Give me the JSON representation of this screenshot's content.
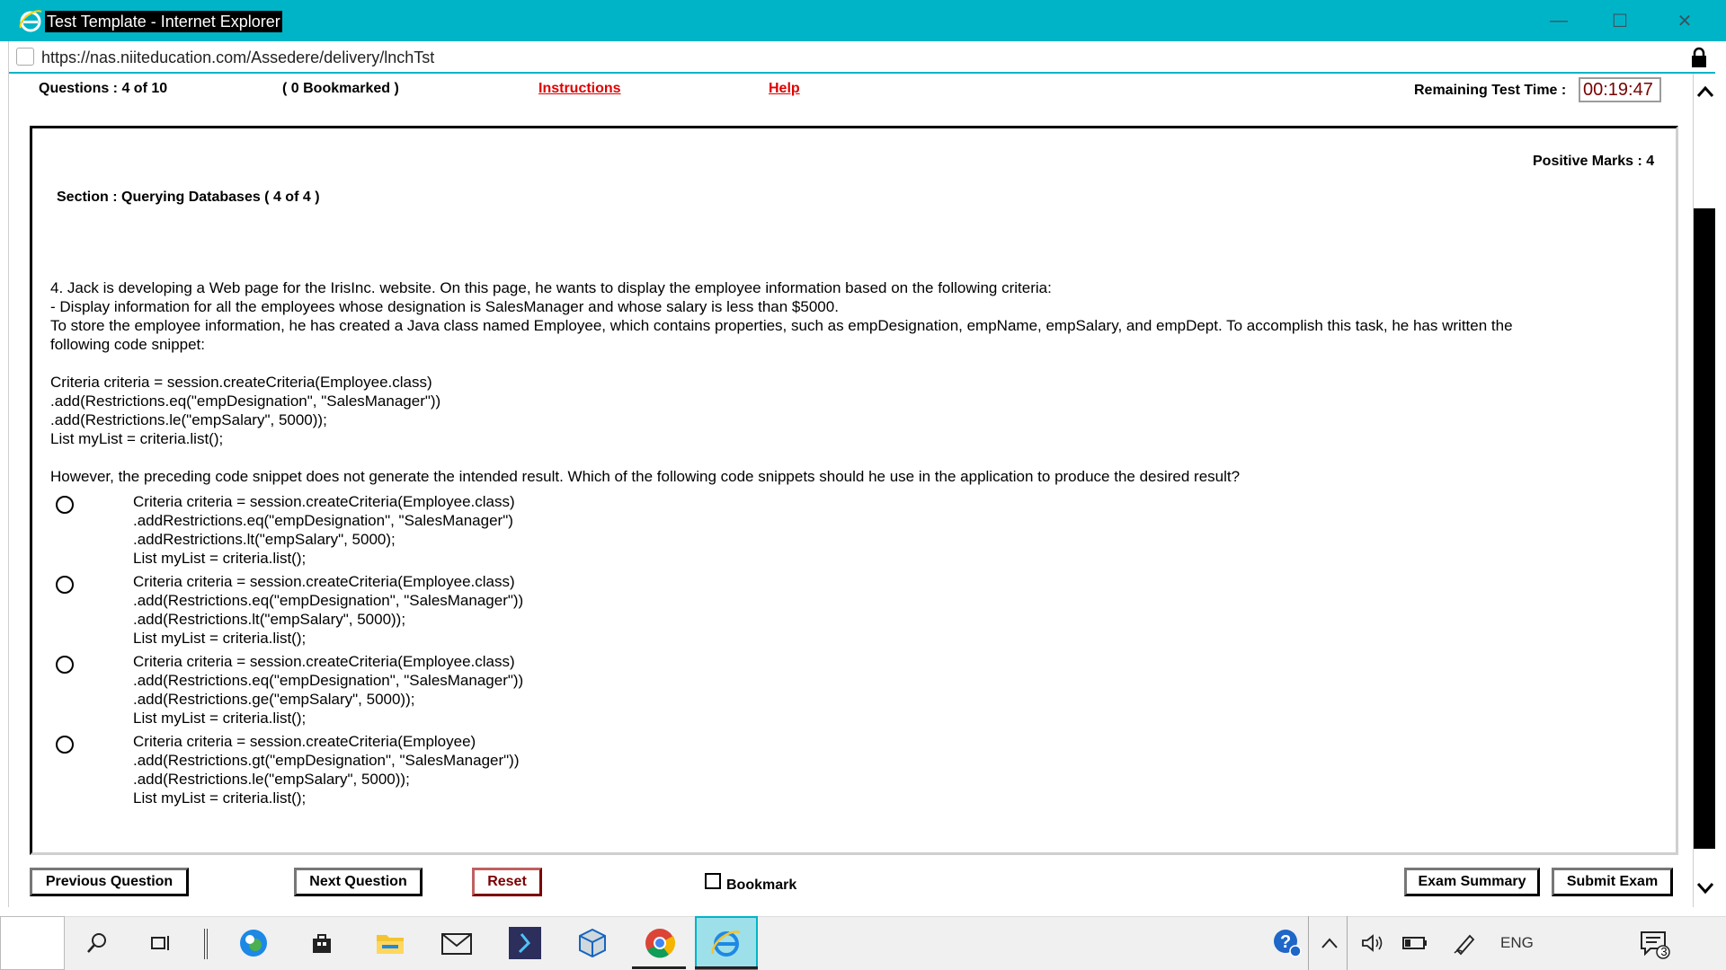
{
  "window": {
    "title": "Test Template - Internet Explorer",
    "url": "https://nas.niiteducation.com/Assedere/delivery/lnchTst",
    "minimize_icon": "minimize-icon",
    "maximize_icon": "maximize-icon",
    "close_icon": "close-icon"
  },
  "header": {
    "questions": "Questions : 4 of 10",
    "bookmarked": "( 0 Bookmarked )",
    "instructions_link": "Instructions",
    "help_link": "Help",
    "remaining_label": "Remaining Test Time :",
    "timer": "00:19:47"
  },
  "panel": {
    "positive_marks": "Positive Marks : 4",
    "section": "Section : Querying Databases ( 4 of 4 )"
  },
  "question": {
    "line1": "4. Jack is developing a Web page for the IrisInc. website. On this page, he wants to display the employee information based on the following criteria:",
    "line2": "- Display information for all the employees whose designation is SalesManager and whose salary is less than $5000.",
    "line3": "To store the employee information, he has created a Java class named Employee, which contains properties, such as empDesignation, empName, empSalary, and empDept. To accomplish this task, he has written the",
    "line4": "following code snippet:",
    "code1": "Criteria criteria = session.createCriteria(Employee.class)",
    "code2": ".add(Restrictions.eq(\"empDesignation\", \"SalesManager\"))",
    "code3": ".add(Restrictions.le(\"empSalary\", 5000));",
    "code4": "List myList = criteria.list();",
    "prompt": "However, the preceding code snippet does not generate the intended result. Which of the following code snippets should he use in the application to produce the desired result?"
  },
  "options": [
    {
      "l1": "Criteria criteria = session.createCriteria(Employee.class)",
      "l2": ".addRestrictions.eq(\"empDesignation\", \"SalesManager\")",
      "l3": ".addRestrictions.lt(\"empSalary\", 5000);",
      "l4": "List myList = criteria.list();"
    },
    {
      "l1": "Criteria criteria = session.createCriteria(Employee.class)",
      "l2": ".add(Restrictions.eq(\"empDesignation\", \"SalesManager\"))",
      "l3": ".add(Restrictions.lt(\"empSalary\", 5000));",
      "l4": "List myList = criteria.list();"
    },
    {
      "l1": "Criteria criteria = session.createCriteria(Employee.class)",
      "l2": ".add(Restrictions.eq(\"empDesignation\", \"SalesManager\"))",
      "l3": ".add(Restrictions.ge(\"empSalary\", 5000));",
      "l4": "List myList = criteria.list();"
    },
    {
      "l1": "Criteria criteria = session.createCriteria(Employee)",
      "l2": ".add(Restrictions.gt(\"empDesignation\", \"SalesManager\"))",
      "l3": ".add(Restrictions.le(\"empSalary\", 5000));",
      "l4": "List myList = criteria.list();"
    }
  ],
  "footer": {
    "previous": "Previous Question",
    "next": "Next Question",
    "reset": "Reset",
    "bookmark": "Bookmark",
    "summary": "Exam Summary",
    "submit": "Submit Exam"
  },
  "taskbar": {
    "language": "ENG",
    "notifications": "3",
    "icons": [
      "search-icon",
      "task-view-icon",
      "edge-icon",
      "store-icon",
      "file-explorer-icon",
      "mail-icon",
      "powershell-icon",
      "virtualbox-icon",
      "chrome-icon",
      "internet-explorer-icon",
      "help-icon",
      "chevron-up-icon",
      "volume-icon",
      "battery-icon",
      "pen-icon",
      "notification-icon"
    ]
  },
  "colors": {
    "titlebar": "#00b4c8",
    "link": "#e00000",
    "timer": "#7a0000"
  }
}
